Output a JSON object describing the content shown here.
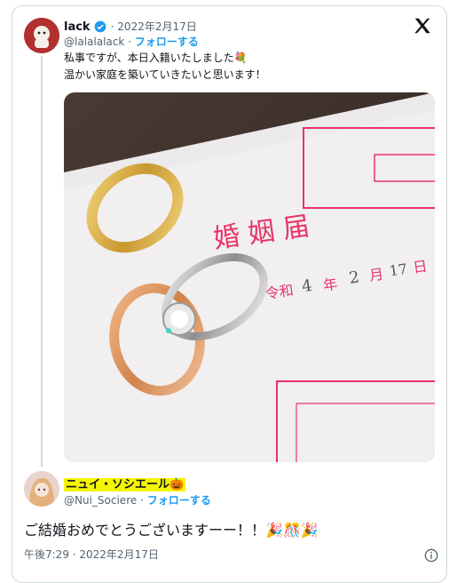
{
  "tweet": {
    "author_name": "lack",
    "date": "2022年2月17日",
    "handle": "@lalalalack",
    "follow": "フォローする",
    "line1": "私事ですが、本日入籍いたしました",
    "line1_emoji": "💐",
    "line2": "温かい家庭を築いていきたいと思います！",
    "photo_text": {
      "form_title": "婚 姻 届",
      "era": "令和",
      "year": "4",
      "year_unit": "年",
      "month": "2",
      "month_unit": "月",
      "day": "17",
      "day_unit": "日"
    }
  },
  "reply": {
    "author_name": "ニュイ・ソシエール",
    "author_emoji": "🎃",
    "handle": "@Nui_Sociere",
    "follow": "フォローする",
    "text": "ご結婚おめでとうございますーー！！",
    "text_emoji": "🎉🎊🎉",
    "timestamp": "午後7:29 · 2022年2月17日"
  },
  "colors": {
    "link": "#1d9bf0",
    "verified": "#1d9bf0",
    "form_pink": "#e8336a",
    "highlight": "#f4f600"
  }
}
